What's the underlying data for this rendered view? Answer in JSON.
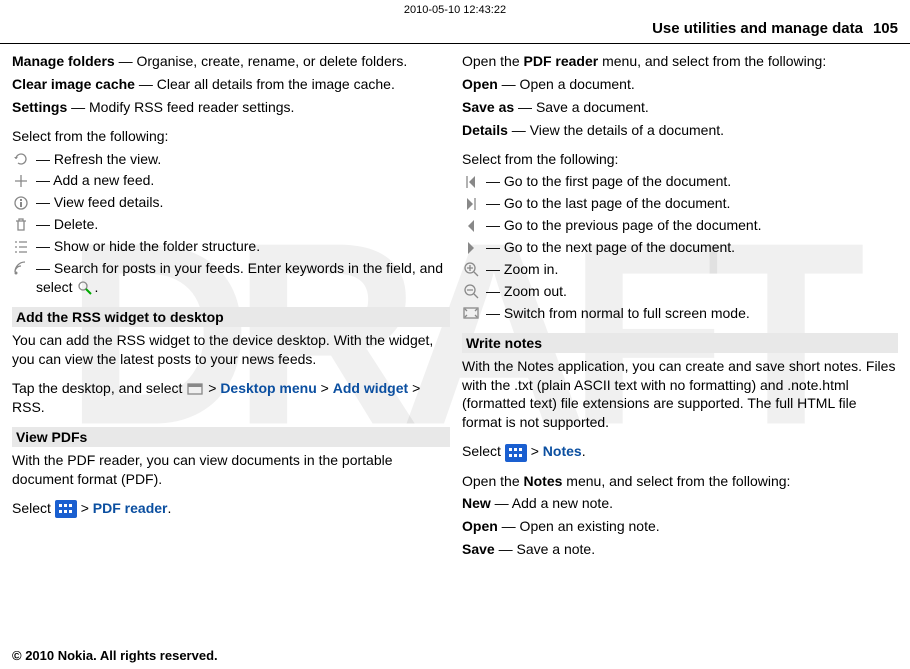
{
  "timestamp": "2010-05-10 12:43:22",
  "header": {
    "title": "Use utilities and manage data",
    "page": "105"
  },
  "left": {
    "manage_folders_t": "Manage folders",
    "manage_folders_d": " — Organise, create, rename, or delete folders.",
    "clear_cache_t": "Clear image cache",
    "clear_cache_d": " — Clear all details from the image cache.",
    "settings_t": "Settings",
    "settings_d": " — Modify RSS feed reader settings.",
    "select_from": "Select from the following:",
    "refresh": " — Refresh the view.",
    "add_feed": " — Add a new feed.",
    "view_details": " — View feed details.",
    "delete": " — Delete.",
    "show_hide": " — Show or hide the folder structure.",
    "search1": " — Search for posts in your feeds. Enter keywords in the field, and select ",
    "search2": ".",
    "rss_head": "Add the RSS widget to desktop",
    "rss_p1": "You can add the RSS widget to the device desktop. With the widget, you can view the latest posts to your news feeds.",
    "rss_p2a": "Tap the desktop, and select ",
    "rss_gt1": " > ",
    "rss_desk": "Desktop menu",
    "rss_gt2": " > ",
    "rss_add": "Add widget",
    "rss_gt3": " > RSS.",
    "pdf_head": "View PDFs",
    "pdf_p1": "With the PDF reader, you can view documents in the portable document format (PDF).",
    "pdf_sel": "Select ",
    "pdf_gt": " > ",
    "pdf_link": "PDF reader",
    "pdf_dot": "."
  },
  "right": {
    "open_menu_a": "Open the ",
    "open_menu_b": "PDF reader",
    "open_menu_c": " menu, and select from the following:",
    "open_t": "Open",
    "open_d": " — Open a document.",
    "saveas_t": "Save as",
    "saveas_d": " — Save a document.",
    "details_t": "Details",
    "details_d": " — View the details of a document.",
    "select_from": "Select from the following:",
    "first": " — Go to the first page of the document.",
    "last": " — Go to the last page of the document.",
    "prev": " — Go to the previous page of the document.",
    "next": " — Go to the next page of the document.",
    "zin": " — Zoom in.",
    "zout": " — Zoom out.",
    "full": " — Switch from normal to full screen mode.",
    "notes_head": "Write notes",
    "notes_p1": "With the Notes application, you can create and save short notes. Files with the .txt (plain ASCII text with no formatting) and .note.html (formatted text) file extensions are supported. The full HTML file format is not supported.",
    "notes_sel": "Select ",
    "notes_gt": " > ",
    "notes_link": "Notes",
    "notes_dot": ".",
    "notes_open_a": "Open the ",
    "notes_open_b": "Notes",
    "notes_open_c": " menu, and select from the following:",
    "new_t": "New",
    "new_d": " — Add a new note.",
    "nopen_t": "Open",
    "nopen_d": " — Open an existing note.",
    "save_t": "Save",
    "save_d": " — Save a note."
  },
  "footer": "© 2010 Nokia. All rights reserved."
}
